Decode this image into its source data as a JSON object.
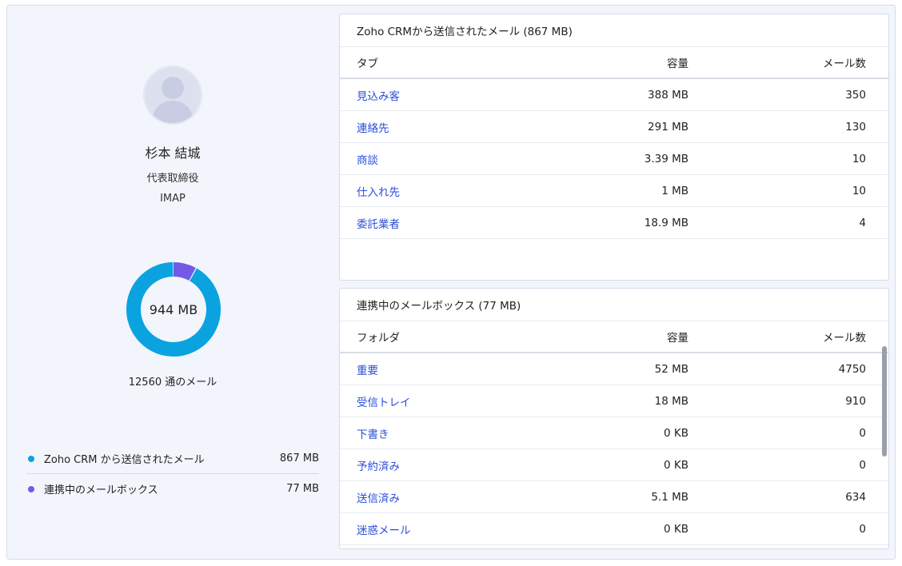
{
  "profile": {
    "name": "杉本 結城",
    "role": "代表取締役",
    "protocol": "IMAP"
  },
  "summary": {
    "total_size": "944 MB",
    "mail_count_text": "12560 通のメール",
    "donut_fractions": [
      0.918,
      0.082
    ],
    "colors": {
      "crm": "#0aa3df",
      "mailbox": "#7259e8"
    }
  },
  "legend": [
    {
      "label": "Zoho CRM から送信されたメール",
      "value": "867 MB",
      "color": "#0aa3df"
    },
    {
      "label": "連携中のメールボックス",
      "value": "77 MB",
      "color": "#7259e8"
    }
  ],
  "crm_table": {
    "title": "Zoho CRMから送信されたメール (867 MB)",
    "headers": [
      "タブ",
      "容量",
      "メール数"
    ],
    "rows": [
      {
        "name": "見込み客",
        "size": "388 MB",
        "count": "350"
      },
      {
        "name": "連絡先",
        "size": "291 MB",
        "count": "130"
      },
      {
        "name": "商談",
        "size": "3.39 MB",
        "count": "10"
      },
      {
        "name": "仕入れ先",
        "size": "1 MB",
        "count": "10"
      },
      {
        "name": "委託業者",
        "size": "18.9 MB",
        "count": "4"
      }
    ]
  },
  "mailbox_table": {
    "title": "連携中のメールボックス (77 MB)",
    "headers": [
      "フォルダ",
      "容量",
      "メール数"
    ],
    "rows": [
      {
        "name": "重要",
        "size": "52 MB",
        "count": "4750"
      },
      {
        "name": "受信トレイ",
        "size": "18 MB",
        "count": "910"
      },
      {
        "name": "下書き",
        "size": "0 KB",
        "count": "0"
      },
      {
        "name": "予約済み",
        "size": "0 KB",
        "count": "0"
      },
      {
        "name": "送信済み",
        "size": "5.1 MB",
        "count": "634"
      },
      {
        "name": "迷惑メール",
        "size": "0 KB",
        "count": "0"
      }
    ]
  }
}
